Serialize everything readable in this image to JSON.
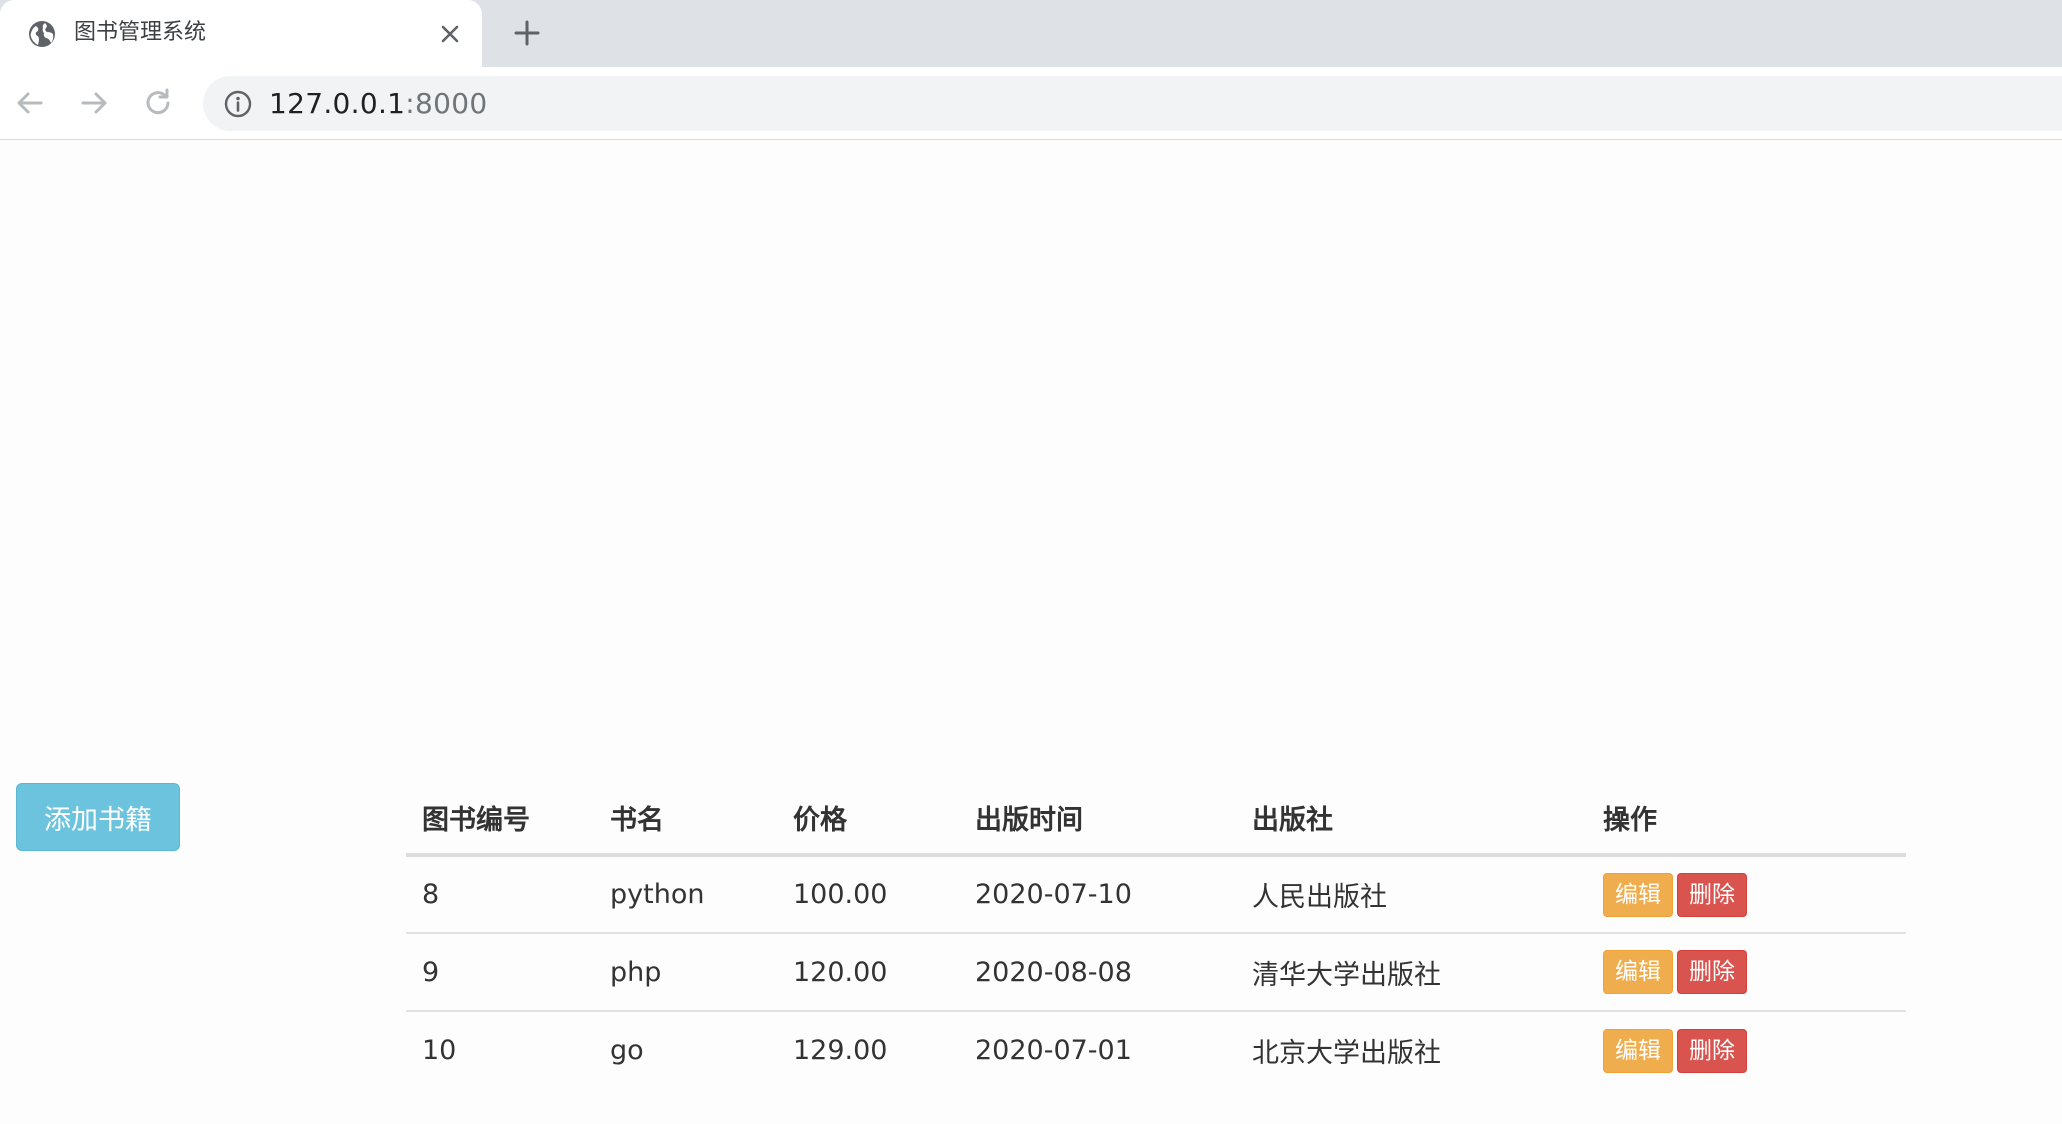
{
  "browser": {
    "tab_title": "图书管理系统",
    "icons": {
      "favicon": "globe-icon",
      "close": "close-icon",
      "new_tab": "plus-icon",
      "back": "back-arrow-icon",
      "forward": "forward-arrow-icon",
      "reload": "reload-icon",
      "info": "info-icon"
    },
    "url_host": "127.0.0.1",
    "url_port": ":8000"
  },
  "page": {
    "add_button_label": "添加书籍",
    "table": {
      "headers": [
        "图书编号",
        "书名",
        "价格",
        "出版时间",
        "出版社",
        "操作"
      ],
      "rows": [
        {
          "id": "8",
          "name": "python",
          "price": "100.00",
          "date": "2020-07-10",
          "publisher": "人民出版社",
          "edit": "编辑",
          "delete": "删除"
        },
        {
          "id": "9",
          "name": "php",
          "price": "120.00",
          "date": "2020-08-08",
          "publisher": "清华大学出版社",
          "edit": "编辑",
          "delete": "删除"
        },
        {
          "id": "10",
          "name": "go",
          "price": "129.00",
          "date": "2020-07-01",
          "publisher": "北京大学出版社",
          "edit": "编辑",
          "delete": "删除"
        }
      ]
    }
  },
  "colors": {
    "add_button": "#6cc3de",
    "edit_button": "#f0ad4e",
    "delete_button": "#d9534f",
    "tabstrip": "#dee1e6"
  }
}
